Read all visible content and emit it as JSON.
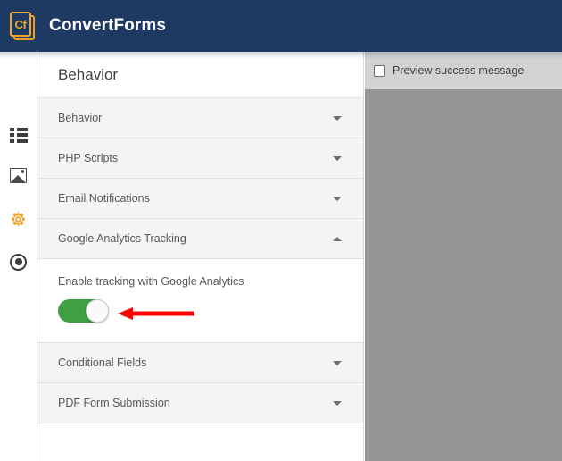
{
  "topbar": {
    "logo_text": "Cf",
    "logo_icon": "convertforms-logo-icon",
    "brand": "ConvertForms",
    "bg_color": "#1e3a63",
    "accent_color": "#f0a629"
  },
  "sidebar": {
    "items": [
      {
        "icon": "list-icon",
        "active": false
      },
      {
        "icon": "image-icon",
        "active": false
      },
      {
        "icon": "gear-icon",
        "active": true
      },
      {
        "icon": "record-icon",
        "active": false
      }
    ],
    "active_color": "#f5a020"
  },
  "main": {
    "title": "Behavior",
    "sections": [
      {
        "label": "Behavior",
        "expanded": false,
        "caret": "chevron-down-icon"
      },
      {
        "label": "PHP Scripts",
        "expanded": false,
        "caret": "chevron-down-icon"
      },
      {
        "label": "Email Notifications",
        "expanded": false,
        "caret": "chevron-down-icon"
      },
      {
        "label": "Google Analytics Tracking",
        "expanded": true,
        "caret": "chevron-up-icon"
      },
      {
        "label": "Conditional Fields",
        "expanded": false,
        "caret": "chevron-down-icon"
      },
      {
        "label": "PDF Form Submission",
        "expanded": false,
        "caret": "chevron-down-icon"
      }
    ],
    "analytics": {
      "field_label": "Enable tracking with Google Analytics",
      "toggle_state": "on",
      "toggle_on_color": "#3fa142"
    },
    "annotation": {
      "shape": "left-pointing-arrow",
      "color": "#ff0000"
    }
  },
  "preview": {
    "checkbox_label": "Preview success message",
    "checkbox_checked": false,
    "header_bg": "#d2d2d2",
    "body_bg": "#969696"
  }
}
